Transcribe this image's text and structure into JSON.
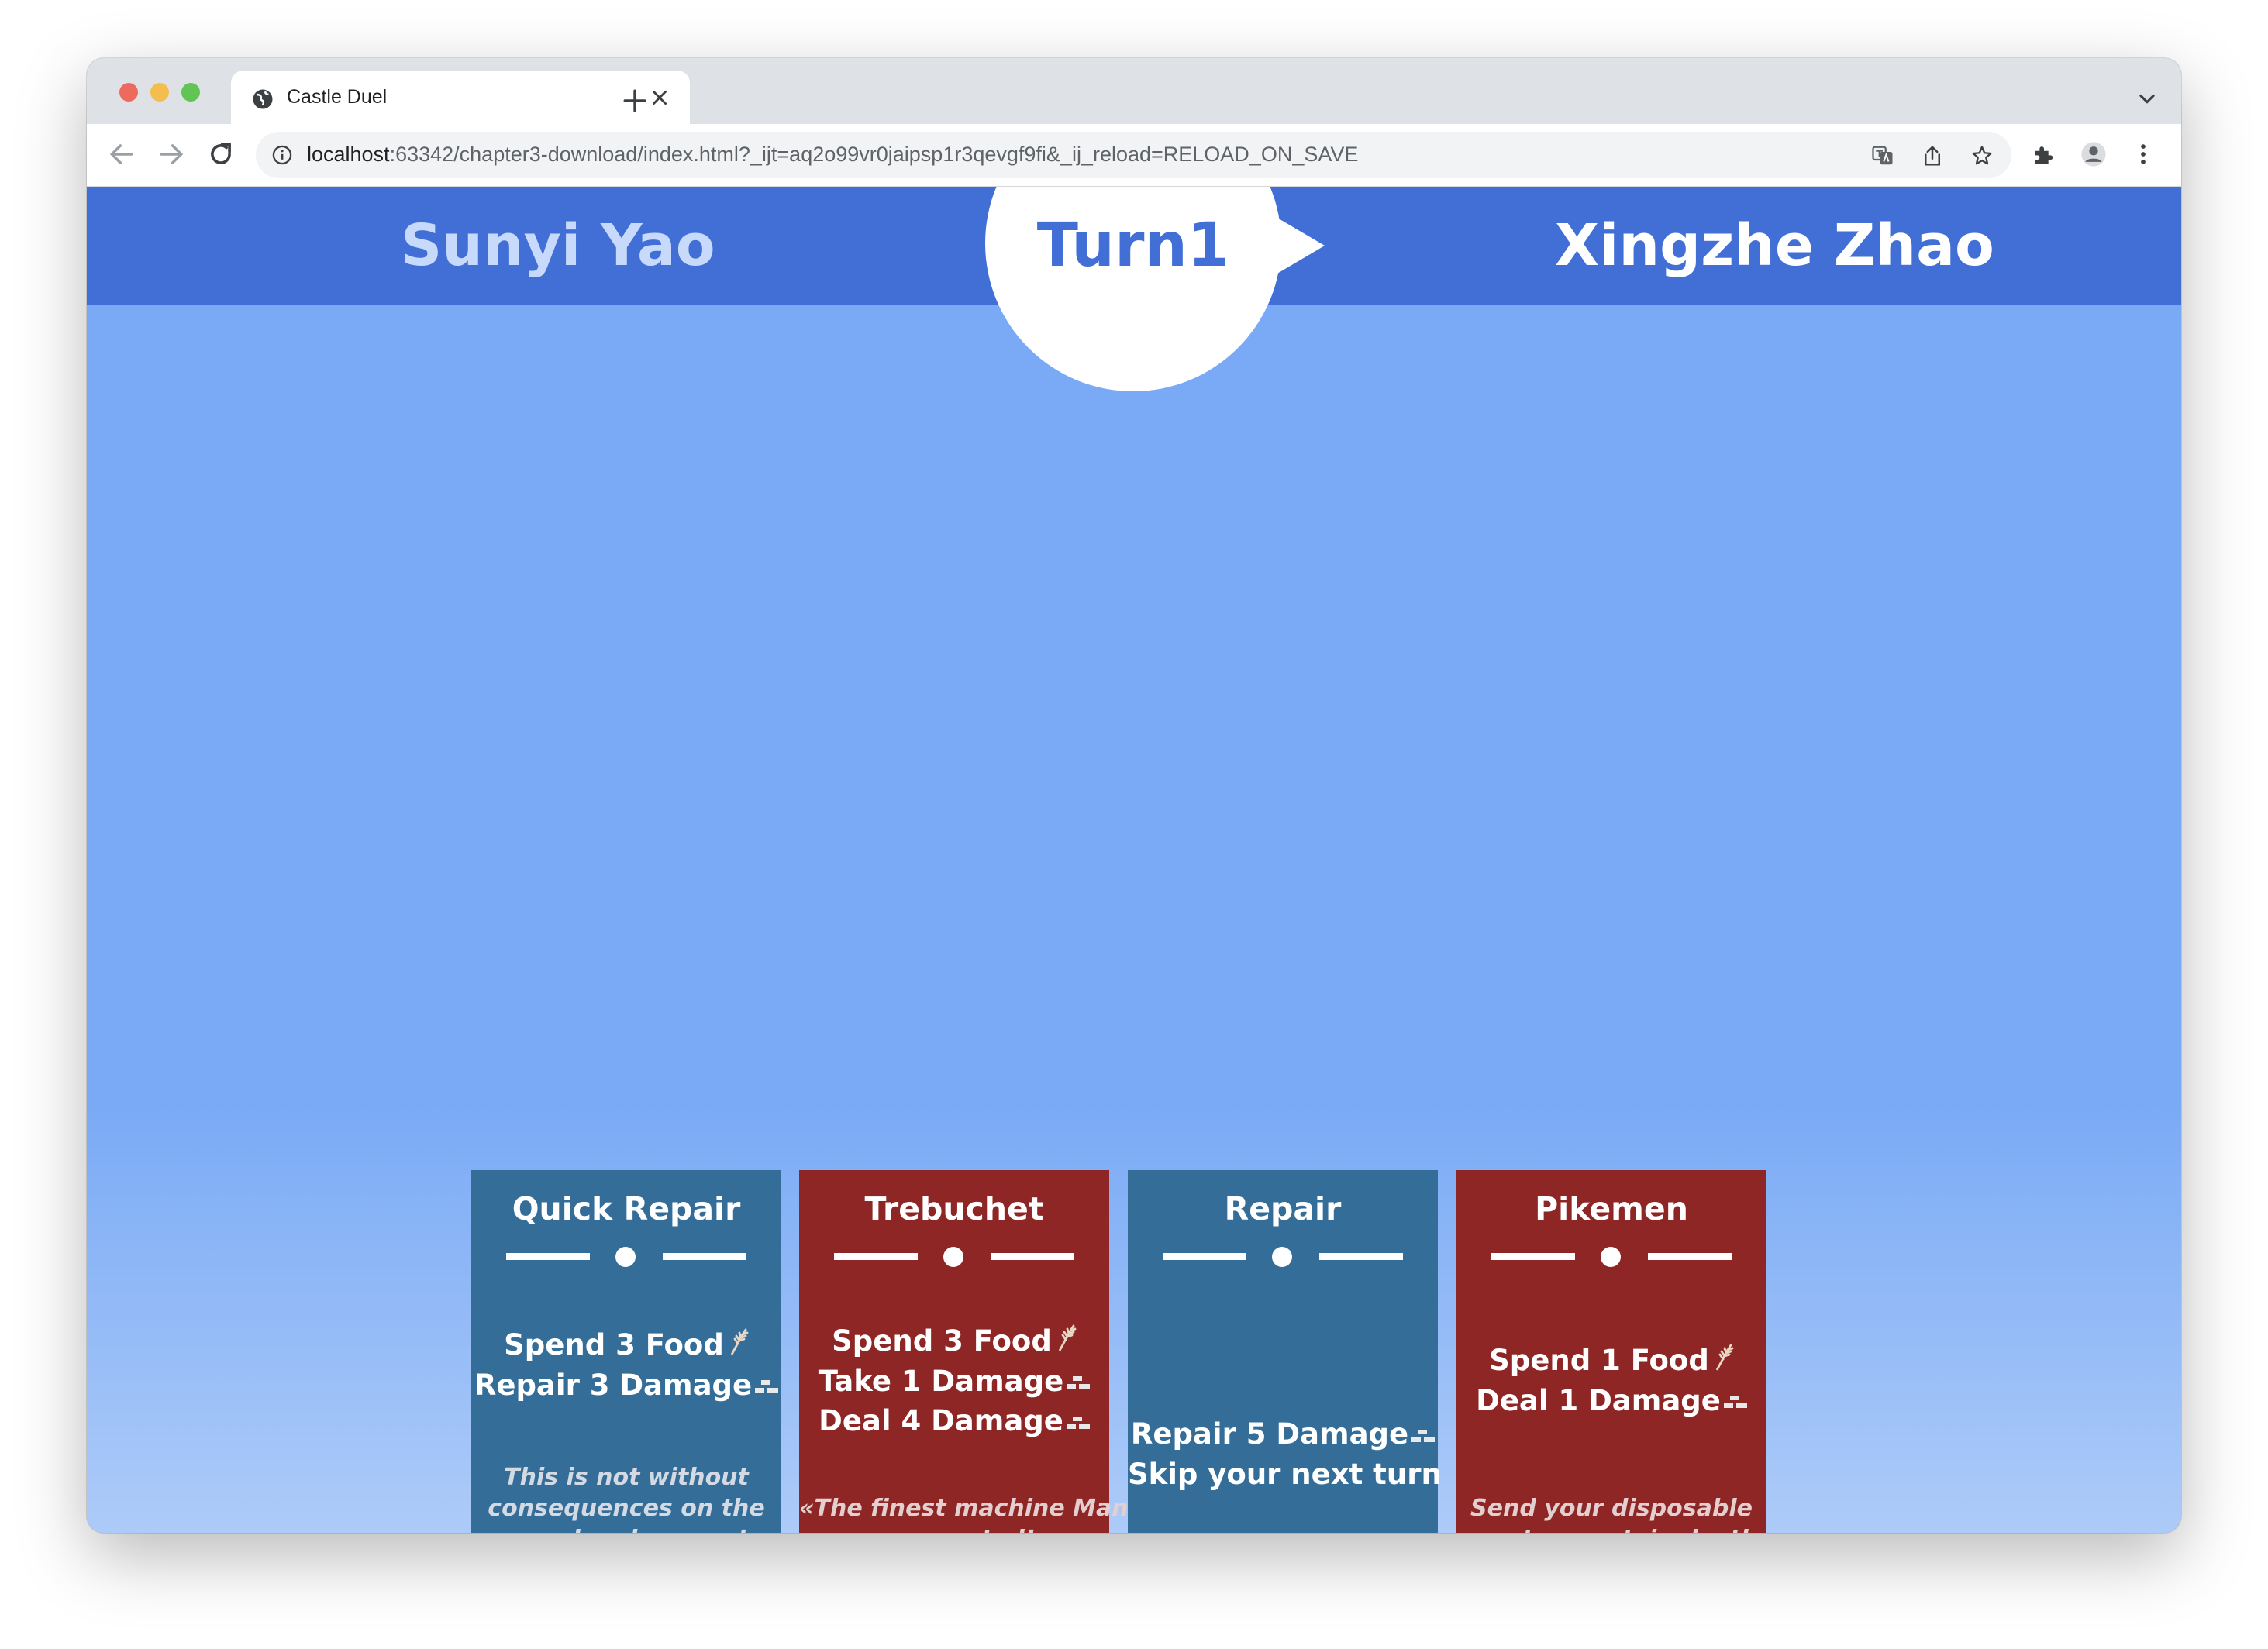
{
  "browser": {
    "tab_title": "Castle Duel",
    "url_host": "localhost",
    "url_rest": ":63342/chapter3-download/index.html?_ijt=aq2o99vr0jaipsp1r3qevgf9fi&_ij_reload=RELOAD_ON_SAVE"
  },
  "game": {
    "player_left": "Sunyi Yao",
    "player_right": "Xingzhe Zhao",
    "turn_label": "Turn1"
  },
  "cards": [
    {
      "title": "Quick Repair",
      "color": "#336d98",
      "lines": [
        {
          "text": "Spend 3 Food",
          "icon": "food-icon"
        },
        {
          "text": "Repair 3 Damage",
          "icon": "damage-icon"
        }
      ],
      "flavor": [
        "This is not without",
        "consequences on the",
        "moral and energy!"
      ]
    },
    {
      "title": "Trebuchet",
      "color": "#8d2624",
      "lines": [
        {
          "text": "Spend 3 Food",
          "icon": "food-icon"
        },
        {
          "text": "Take 1 Damage",
          "icon": "damage-icon"
        },
        {
          "text": "Deal 4 Damage",
          "icon": "damage-icon"
        }
      ],
      "flavor": [
        "«The finest machine Man",
        "ever created!»"
      ]
    },
    {
      "title": "Repair",
      "color": "#336d98",
      "lines": [
        {
          "text": "Repair 5 Damage",
          "icon": "damage-icon"
        },
        {
          "text": "Skip your next turn",
          "icon": ""
        }
      ],
      "flavor": []
    },
    {
      "title": "Pikemen",
      "color": "#8d2624",
      "lines": [
        {
          "text": "Spend 1 Food",
          "icon": "food-icon"
        },
        {
          "text": "Deal 1 Damage",
          "icon": "damage-icon"
        }
      ],
      "flavor": [
        "Send your disposable",
        "men to a certain death."
      ]
    }
  ]
}
